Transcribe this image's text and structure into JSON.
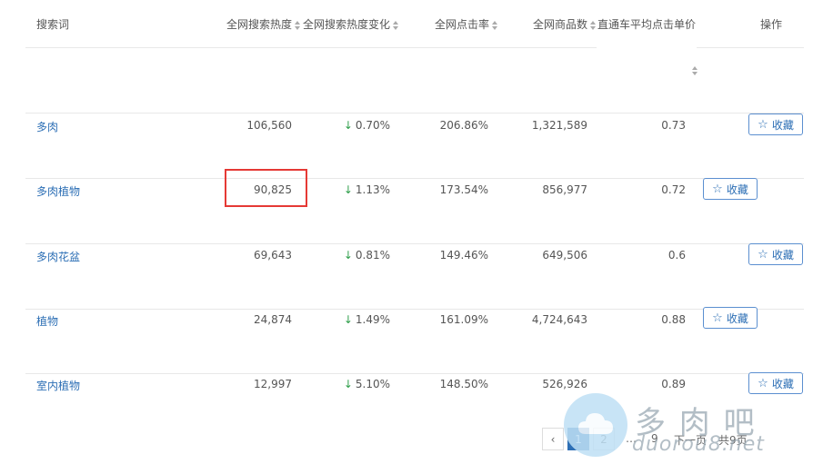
{
  "headers": {
    "keyword": "搜索词",
    "heat": "全网搜索热度",
    "heat_change": "全网搜索热度变化",
    "ctr": "全网点击率",
    "products": "全网商品数",
    "ztc_cpc": "直通车平均点击单价",
    "action": "操作"
  },
  "rows": [
    {
      "keyword": "多肉",
      "heat": "106,560",
      "change": "0.70%",
      "ctr": "206.86%",
      "products": "1,321,589",
      "cpc": "0.73",
      "fav": "收藏"
    },
    {
      "keyword": "多肉植物",
      "heat": "90,825",
      "change": "1.13%",
      "ctr": "173.54%",
      "products": "856,977",
      "cpc": "0.72",
      "fav": "收藏"
    },
    {
      "keyword": "多肉花盆",
      "heat": "69,643",
      "change": "0.81%",
      "ctr": "149.46%",
      "products": "649,506",
      "cpc": "0.6",
      "fav": "收藏"
    },
    {
      "keyword": "植物",
      "heat": "24,874",
      "change": "1.49%",
      "ctr": "161.09%",
      "products": "4,724,643",
      "cpc": "0.88",
      "fav": "收藏"
    },
    {
      "keyword": "室内植物",
      "heat": "12,997",
      "change": "5.10%",
      "ctr": "148.50%",
      "products": "526,926",
      "cpc": "0.89",
      "fav": "收藏"
    }
  ],
  "change_arrow": "↓",
  "star_icon": "☆",
  "pagination": {
    "prev": "‹",
    "pages": [
      "1",
      "2"
    ],
    "ellipsis": "…",
    "last": "9",
    "next_label": "下一页",
    "total_label": "共9页"
  },
  "watermark": {
    "cn": "多 肉 吧",
    "en": "duorou8.net"
  },
  "colors": {
    "link": "#2d6fb5",
    "down": "#2e9e4a",
    "highlight": "#e53935"
  }
}
